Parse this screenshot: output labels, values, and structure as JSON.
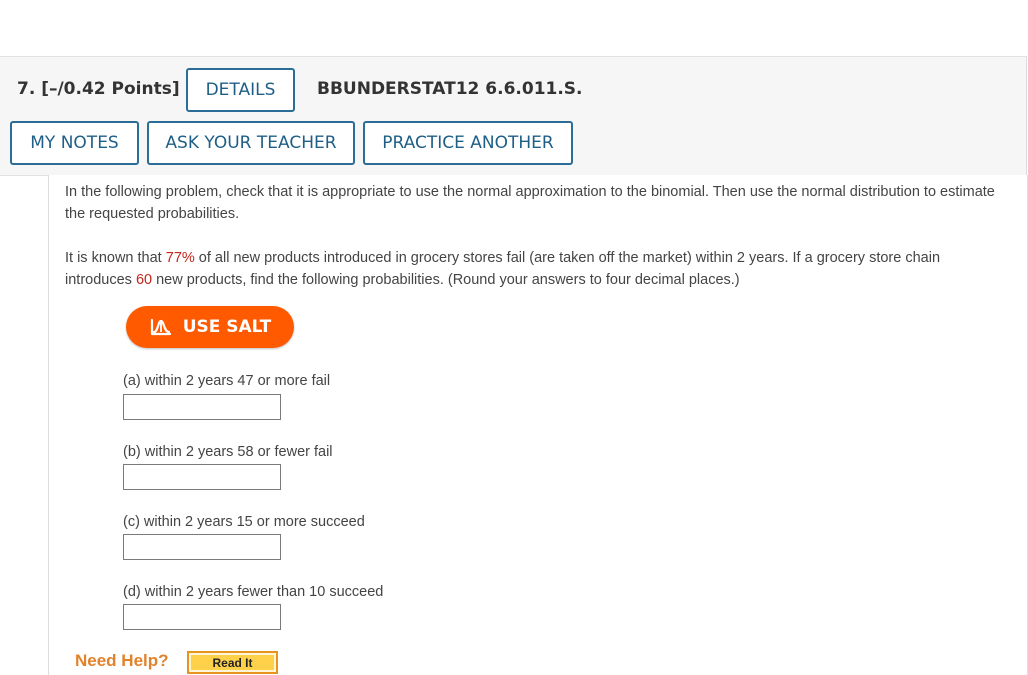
{
  "question": {
    "number_points": "7.  [–/0.42 Points]",
    "details_label": "DETAILS",
    "code": "BBUNDERSTAT12 6.6.011.S."
  },
  "actions": {
    "my_notes": "MY NOTES",
    "ask_teacher": "ASK YOUR TEACHER",
    "practice_another": "PRACTICE ANOTHER"
  },
  "problem": {
    "intro": "In the following problem, check that it is appropriate to use the normal approximation to the binomial. Then use the normal distribution to estimate the requested probabilities.",
    "text_1": "It is known that ",
    "percent": "77%",
    "text_2": " of all new products introduced in grocery stores fail (are taken off the market) within 2 years. If a grocery store chain introduces ",
    "count": "60",
    "text_3": " new products, find the following probabilities. (Round your answers to four decimal places.)"
  },
  "salt": {
    "label": "USE SALT",
    "icon": "salt-chart-icon"
  },
  "parts": [
    {
      "label": "(a) within 2 years 47 or more fail",
      "value": ""
    },
    {
      "label": "(b) within 2 years 58 or fewer fail",
      "value": ""
    },
    {
      "label": "(c) within 2 years 15 or more succeed",
      "value": ""
    },
    {
      "label": "(d) within 2 years fewer than 10 succeed",
      "value": ""
    }
  ],
  "help": {
    "need_help": "Need Help?",
    "read_it": "Read It"
  },
  "colors": {
    "accent_blue": "#2b6d96",
    "highlight_red": "#c4241a",
    "salt_orange": "#ff5a00",
    "help_orange": "#e2822a",
    "read_it_yellow": "#ffd04a"
  }
}
